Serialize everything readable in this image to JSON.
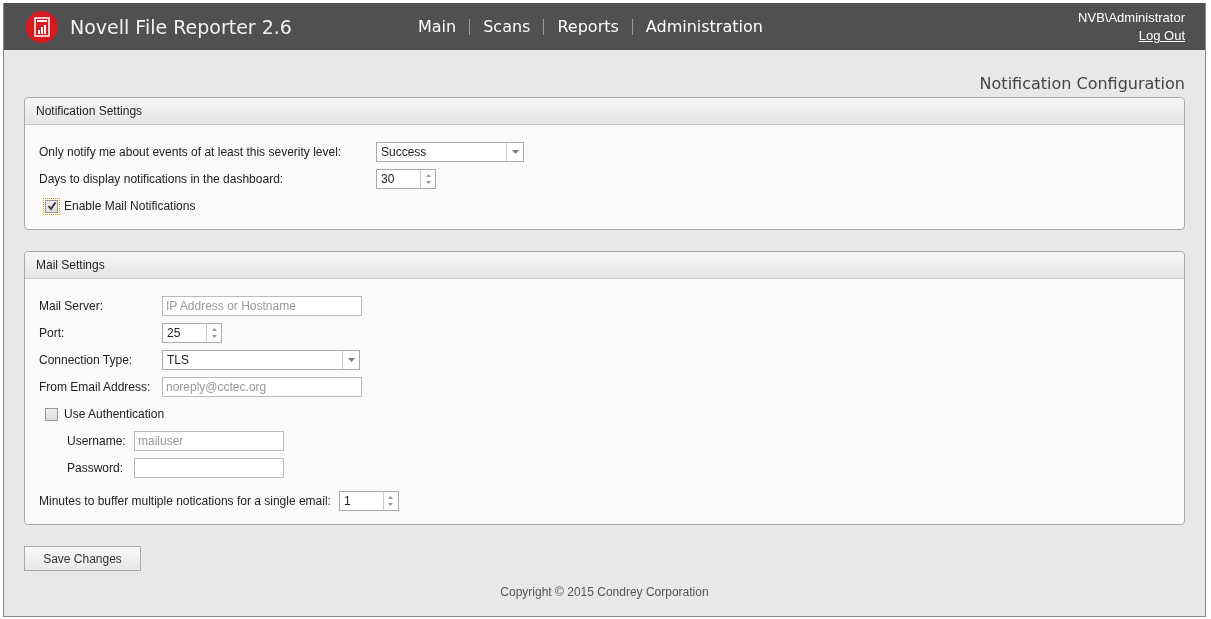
{
  "header": {
    "app_title": "Novell File Reporter 2.6",
    "nav": [
      {
        "label": "Main"
      },
      {
        "label": "Scans"
      },
      {
        "label": "Reports"
      },
      {
        "label": "Administration"
      }
    ],
    "user": "NVB\\Administrator",
    "logout": "Log Out"
  },
  "page_title": "Notification Configuration",
  "panels": [
    {
      "title": "Notification Settings",
      "rows": [
        {
          "kind": "select",
          "label": "Only notify me about events of at least this severity level:",
          "value": "Success"
        },
        {
          "kind": "spinner",
          "label": "Days to display notifications in the dashboard:",
          "value": "30"
        },
        {
          "kind": "checkbox",
          "label": "Enable Mail Notifications",
          "checked": true
        }
      ]
    },
    {
      "title": "Mail Settings",
      "rows": [
        {
          "kind": "text",
          "label": "Mail Server:",
          "placeholder": "IP Address or Hostname"
        },
        {
          "kind": "spinner",
          "label": "Port:",
          "value": "25"
        },
        {
          "kind": "select",
          "label": "Connection Type:",
          "value": "TLS"
        },
        {
          "kind": "text",
          "label": "From Email Address:",
          "placeholder": "noreply@cctec.org"
        },
        {
          "kind": "checkbox",
          "label": "Use Authentication",
          "checked": false,
          "children": [
            {
              "kind": "text",
              "label": "Username:",
              "placeholder": "mailuser"
            },
            {
              "kind": "text",
              "label": "Password:"
            }
          ]
        },
        {
          "kind": "spinner",
          "label": "Minutes to buffer multiple notications for a single email:",
          "value": "1"
        }
      ]
    }
  ],
  "save_button": "Save Changes",
  "footer": "Copyright © 2015 Condrey Corporation"
}
